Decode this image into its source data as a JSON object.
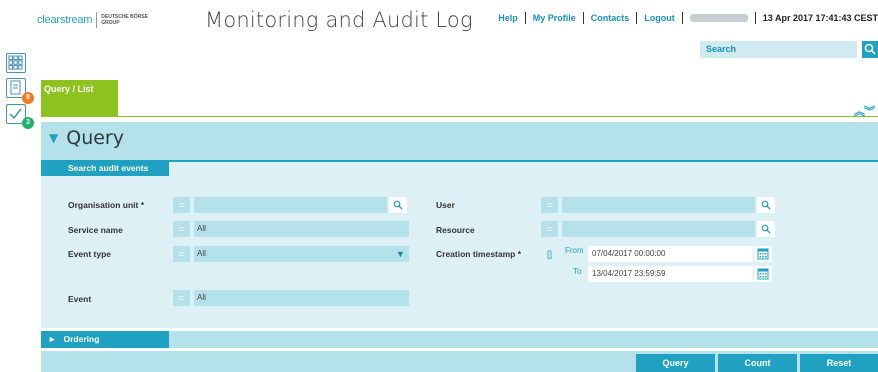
{
  "header": {
    "logo_main": "clearstream",
    "logo_sub_1": "DEUTSCHE BÖRSE",
    "logo_sub_2": "GROUP",
    "title": "Monitoring and Audit Log",
    "nav": {
      "help": "Help",
      "my_profile": "My Profile",
      "contacts": "Contacts",
      "logout": "Logout",
      "datetime": "13 Apr 2017 17:41:43 CEST"
    },
    "search": {
      "label": "Search",
      "icon": "search-icon"
    }
  },
  "sidebar": {
    "items": [
      {
        "icon": "grid-icon"
      },
      {
        "icon": "clipboard-icon",
        "badge": "8",
        "badge_color": "#f07b22"
      },
      {
        "icon": "checklist-icon",
        "badge": "3",
        "badge_color": "#21b16d"
      }
    ]
  },
  "tabs": {
    "active_label": "Query / List"
  },
  "query": {
    "title": "Query",
    "section_tab": "Search audit events",
    "fields": {
      "organisation_unit": {
        "label": "Organisation unit *",
        "op": "=",
        "value": ""
      },
      "service_name": {
        "label": "Service name",
        "op": "=",
        "value": "All"
      },
      "event_type": {
        "label": "Event type",
        "op": "=",
        "value": "All"
      },
      "event": {
        "label": "Event",
        "op": "=",
        "value": "All"
      },
      "user": {
        "label": "User",
        "op": "=",
        "value": ""
      },
      "resource": {
        "label": "Resource",
        "op": "=",
        "value": ""
      },
      "creation_timestamp": {
        "label": "Creation timestamp *",
        "op": "[]",
        "from_label": "From",
        "from_value": "07/04/2017 00:00:00",
        "to_label": "To",
        "to_value": "13/04/2017 23:59:59"
      }
    },
    "ordering_label": "Ordering",
    "buttons": {
      "query": "Query",
      "count": "Count",
      "reset": "Reset"
    }
  },
  "colors": {
    "accent": "#21a1c1",
    "tab_green": "#8dc21f",
    "panel": "#b5e1ea",
    "panel_light": "#ddf0f5"
  }
}
